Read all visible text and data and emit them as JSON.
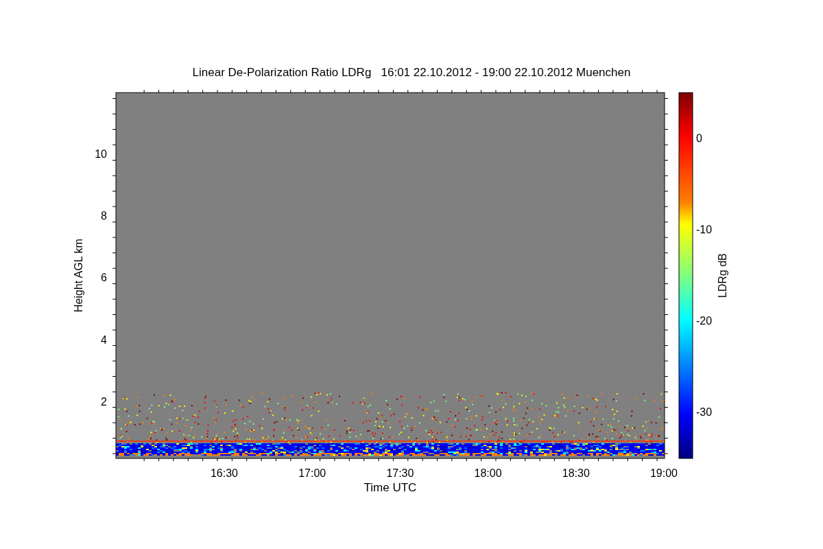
{
  "title": "Linear De-Polarization Ratio LDRg   16:01 22.10.2012 - 19:00 22.10.2012 Muenchen",
  "y_axis": {
    "label": "Height AGL km",
    "ticks": [
      "10",
      "8",
      "6",
      "4",
      "2"
    ]
  },
  "x_axis": {
    "label": "Time UTC",
    "ticks": [
      "16:30",
      "17:00",
      "17:30",
      "18:00",
      "18:30",
      "19:00"
    ]
  },
  "colorbar": {
    "label": "LDRg dB",
    "ticks": [
      "0",
      "-10",
      "-20",
      "-30"
    ]
  }
}
